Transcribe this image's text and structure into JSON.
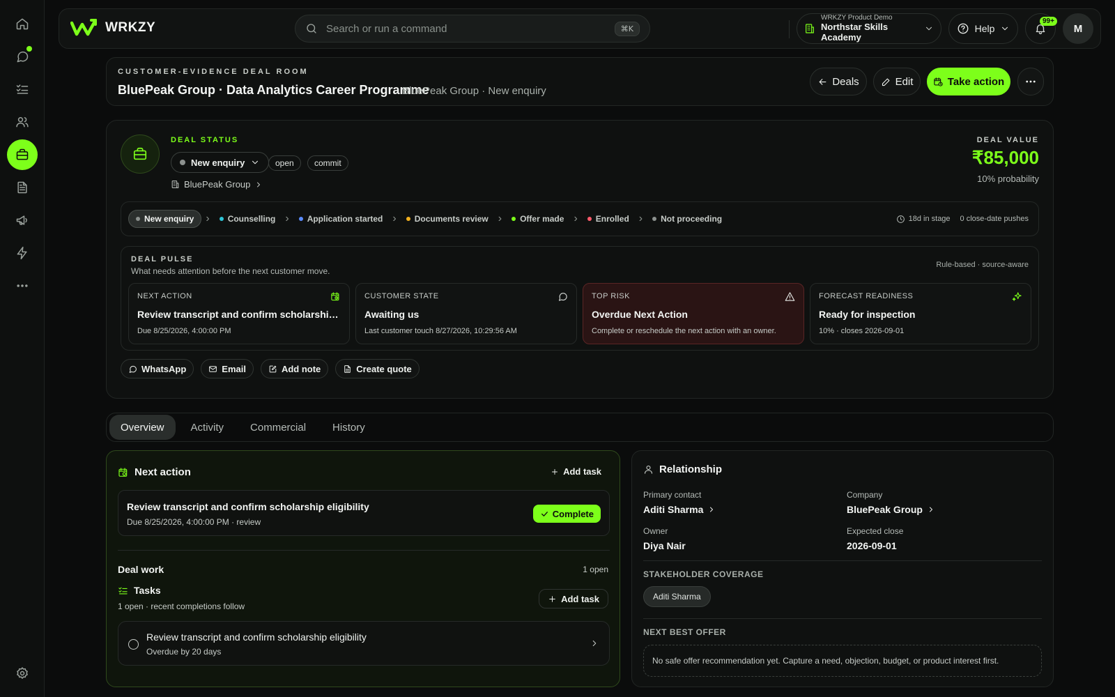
{
  "app": {
    "name": "WRKZY"
  },
  "search": {
    "placeholder": "Search or run a command",
    "shortcut": "⌘K"
  },
  "org": {
    "label": "WRKZY Product Demo",
    "name": "Northstar Skills Academy"
  },
  "help": {
    "label": "Help"
  },
  "notifications": {
    "badge": "99+"
  },
  "user": {
    "initial": "M"
  },
  "rail": [
    "home-icon",
    "chat-icon",
    "checklist-icon",
    "users-icon",
    "briefcase-icon",
    "document-icon",
    "megaphone-icon",
    "bolt-icon",
    "more-icon",
    "settings-icon"
  ],
  "header": {
    "eyebrow": "CUSTOMER-EVIDENCE DEAL ROOM",
    "title": "BluePeak Group · Data Analytics Career Programme",
    "subtitle": "BluePeak Group · New enquiry",
    "deals_label": "Deals",
    "edit_label": "Edit",
    "take_action_label": "Take action"
  },
  "deal": {
    "status_label": "DEAL STATUS",
    "stage": "New enquiry",
    "chips": [
      "open",
      "commit"
    ],
    "company": "BluePeak Group",
    "value_label": "DEAL VALUE",
    "value": "₹85,000",
    "probability": "10% probability"
  },
  "pipeline": {
    "stages": [
      {
        "label": "New enquiry",
        "color": "#8c918e",
        "current": true
      },
      {
        "label": "Counselling",
        "color": "#2ec4d6"
      },
      {
        "label": "Application started",
        "color": "#5b8cff"
      },
      {
        "label": "Documents review",
        "color": "#f2b01e"
      },
      {
        "label": "Offer made",
        "color": "#7dff1a"
      },
      {
        "label": "Enrolled",
        "color": "#ff5a6a"
      },
      {
        "label": "Not proceeding",
        "color": "#8c918e"
      }
    ],
    "days_in_stage": "18d in stage",
    "pushes": "0 close-date pushes"
  },
  "pulse": {
    "label": "DEAL PULSE",
    "subtitle": "What needs attention before the next customer move.",
    "rule": "Rule-based · source-aware",
    "cards": [
      {
        "label": "NEXT ACTION",
        "title": "Review transcript and confirm scholarship eligibility",
        "sub": "Due 8/25/2026, 4:00:00 PM",
        "icon": "calendar-clock-icon"
      },
      {
        "label": "CUSTOMER STATE",
        "title": "Awaiting us",
        "sub": "Last customer touch 8/27/2026, 10:29:56 AM",
        "icon": "chat-icon"
      },
      {
        "label": "TOP RISK",
        "title": "Overdue Next Action",
        "sub": "Complete or reschedule the next action with an owner.",
        "icon": "warning-icon"
      },
      {
        "label": "FORECAST READINESS",
        "title": "Ready for inspection",
        "sub": "10% · closes 2026-09-01",
        "icon": "sparkle-icon"
      }
    ]
  },
  "quick_actions": {
    "whatsapp": "WhatsApp",
    "email": "Email",
    "note": "Add note",
    "quote": "Create quote"
  },
  "tabs": [
    "Overview",
    "Activity",
    "Commercial",
    "History"
  ],
  "next_action": {
    "title": "Next action",
    "add_task": "Add task",
    "task_title": "Review transcript and confirm scholarship eligibility",
    "task_sub": "Due 8/25/2026, 4:00:00 PM · review",
    "complete": "Complete"
  },
  "deal_work": {
    "title": "Deal work",
    "count": "1 open",
    "tasks_title": "Tasks",
    "tasks_sub": "1 open · recent completions follow",
    "add_task": "Add task",
    "row_title": "Review transcript and confirm scholarship eligibility",
    "row_sub": "Overdue by 20 days"
  },
  "relationship": {
    "title": "Relationship",
    "primary_contact_label": "Primary contact",
    "primary_contact": "Aditi Sharma",
    "company_label": "Company",
    "company": "BluePeak Group",
    "owner_label": "Owner",
    "owner": "Diya Nair",
    "close_label": "Expected close",
    "close": "2026-09-01",
    "stakeholder_label": "STAKEHOLDER COVERAGE",
    "stakeholder": "Aditi Sharma",
    "nbo_label": "NEXT BEST OFFER",
    "nbo": "No safe offer recommendation yet. Capture a need, objection, budget, or product interest first."
  }
}
